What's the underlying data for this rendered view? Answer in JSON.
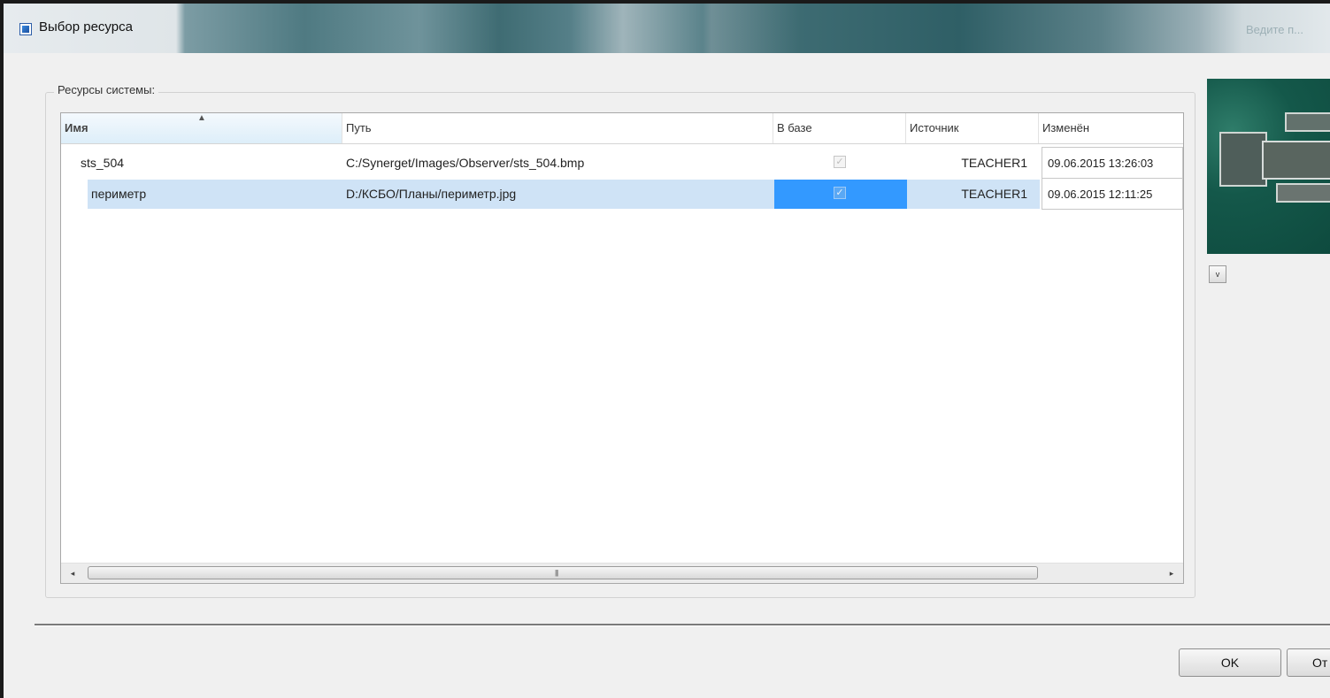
{
  "window": {
    "title": "Выбор ресурса",
    "title_right": "Ведите п..."
  },
  "group": {
    "label": "Ресурсы системы:"
  },
  "table": {
    "columns": [
      "Имя",
      "Путь",
      "В базе",
      "Источник",
      "Изменён"
    ],
    "rows": [
      {
        "name": "sts_504",
        "path": "C:/Synerget/Images/Observer/sts_504.bmp",
        "in_db": "✓",
        "source": "TEACHER1",
        "modified": "09.06.2015 13:26:03"
      },
      {
        "name": "периметр",
        "path": "D:/КСБО/Планы/периметр.jpg",
        "in_db": "✓",
        "source": "TEACHER1",
        "modified": "09.06.2015 12:11:25"
      }
    ],
    "selected_row": 1
  },
  "scrollbar": {
    "left_arrow": "◂",
    "right_arrow": "▸",
    "grip": "|||"
  },
  "preview": {
    "expand_label": "v"
  },
  "buttons": {
    "ok": "OK",
    "cancel": "От"
  },
  "icons": {
    "app": "window-resource-icon",
    "sort": "sort-ascending-icon",
    "check": "checkbox-checked-icon"
  }
}
